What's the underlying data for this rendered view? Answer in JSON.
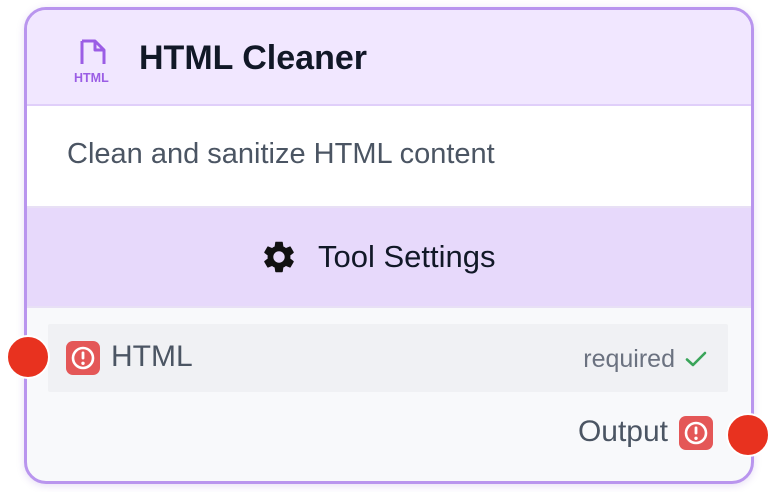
{
  "node": {
    "title": "HTML Cleaner",
    "icon": "html-file-icon",
    "icon_text": "HTML",
    "description": "Clean and sanitize HTML content",
    "settings_label": "Tool Settings",
    "input": {
      "label": "HTML",
      "status": "required",
      "status_icon": "check-icon",
      "badge_icon": "alert-icon"
    },
    "output": {
      "label": "Output",
      "badge_icon": "alert-icon"
    }
  },
  "colors": {
    "border": "#b995ee",
    "header_bg": "#f1e7ff",
    "settings_bg": "#e7d9fb",
    "port": "#e8321f",
    "alert": "#e45757",
    "check": "#3aa55a",
    "accent": "#9b5de5"
  }
}
